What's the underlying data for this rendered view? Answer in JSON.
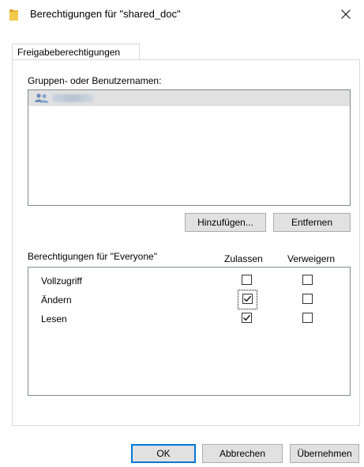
{
  "window": {
    "title": "Berechtigungen für \"shared_doc\"",
    "close_glyph": "✕",
    "folder_icon": "folder-icon",
    "close_icon": "close-icon"
  },
  "tab": {
    "label": "Freigabeberechtigungen"
  },
  "groups": {
    "label": "Gruppen- oder Benutzernamen:",
    "items": [
      {
        "name": "Everyone",
        "icon": "users-icon",
        "selected": true,
        "blurred": true
      }
    ]
  },
  "buttons": {
    "add": "Hinzufügen...",
    "remove": "Entfernen",
    "ok": "OK",
    "cancel": "Abbrechen",
    "apply": "Übernehmen"
  },
  "permissions": {
    "label": "Berechtigungen für \"Everyone\"",
    "allow_header": "Zulassen",
    "deny_header": "Verweigern",
    "rows": [
      {
        "name": "Vollzugriff",
        "allow": false,
        "deny": false
      },
      {
        "name": "Ändern",
        "allow": true,
        "deny": false
      },
      {
        "name": "Lesen",
        "allow": true,
        "deny": false
      }
    ]
  },
  "colors": {
    "accent": "#0078d7",
    "button_bg": "#e1e1e1",
    "border": "#828790",
    "selected_row": "#e1e1e1"
  }
}
